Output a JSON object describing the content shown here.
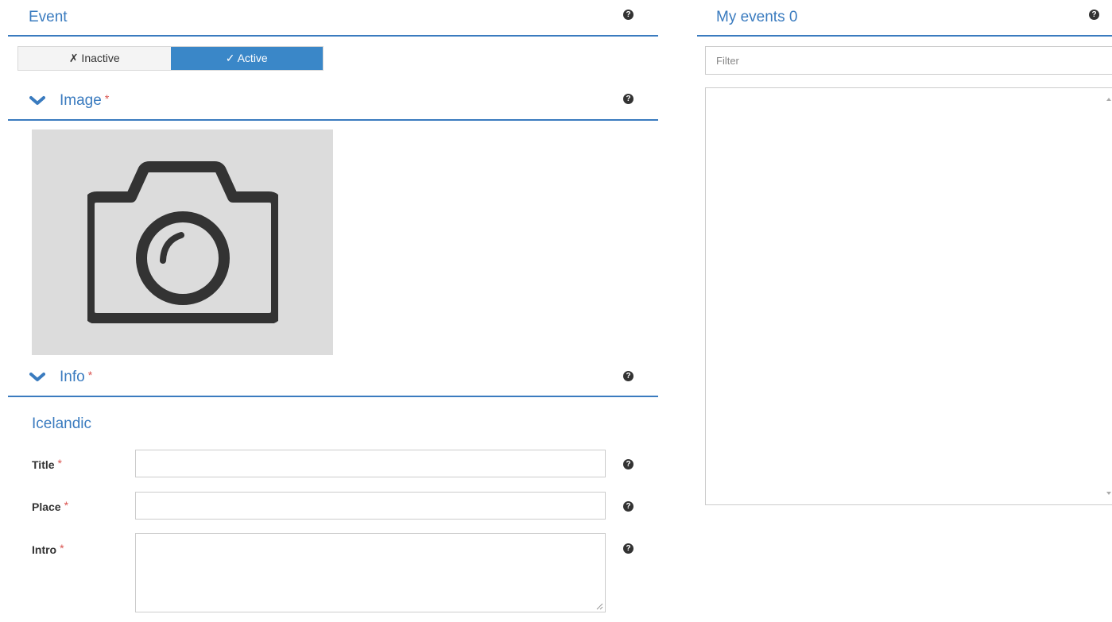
{
  "event": {
    "title": "Event",
    "toggle": {
      "inactive_label": "✗ Inactive",
      "active_label": "✓ Active",
      "selected": "active"
    }
  },
  "image_section": {
    "title": "Image",
    "required_mark": "*"
  },
  "info_section": {
    "title": "Info",
    "required_mark": "*",
    "language": "Icelandic",
    "fields": {
      "title": {
        "label": "Title",
        "required_mark": "*",
        "value": ""
      },
      "place": {
        "label": "Place",
        "required_mark": "*",
        "value": ""
      },
      "intro": {
        "label": "Intro",
        "required_mark": "*",
        "value": ""
      }
    }
  },
  "my_events": {
    "title": "My events 0",
    "filter_placeholder": "Filter"
  },
  "help_glyph": "?",
  "colors": {
    "accent": "#3a7bbf",
    "active_toggle": "#3a87c8",
    "required": "#d9534f",
    "image_bg": "#dcdcdc"
  }
}
